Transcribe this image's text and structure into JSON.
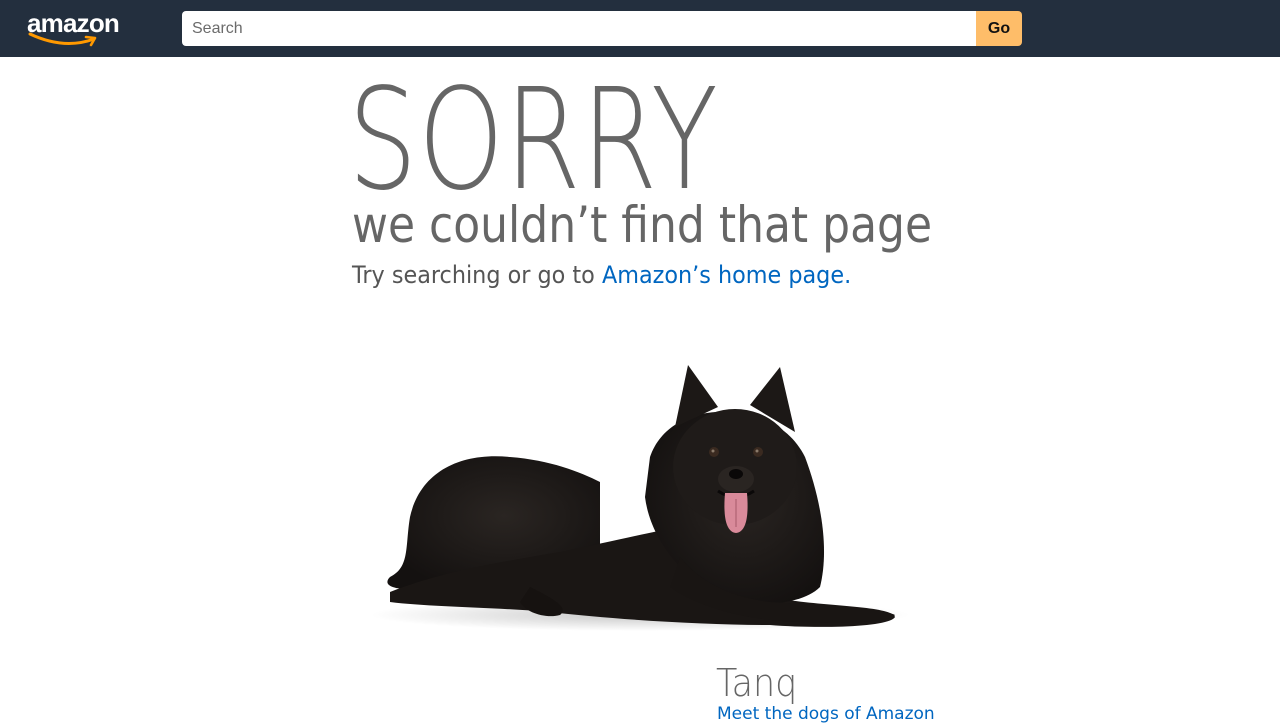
{
  "header": {
    "logo_text": "amazon",
    "search_placeholder": "Search",
    "go_label": "Go"
  },
  "error": {
    "title": "SORRY",
    "subtitle": "we couldn’t find that page",
    "try_text": "Try searching or go to ",
    "home_link_label": "Amazon’s home page",
    "home_link_suffix": "."
  },
  "dog": {
    "name": "Tanq",
    "link_label": "Meet the dogs of Amazon"
  },
  "colors": {
    "topbar": "#232f3e",
    "go_button": "#febd69",
    "link": "#0066c0",
    "text_gray": "#666666"
  }
}
